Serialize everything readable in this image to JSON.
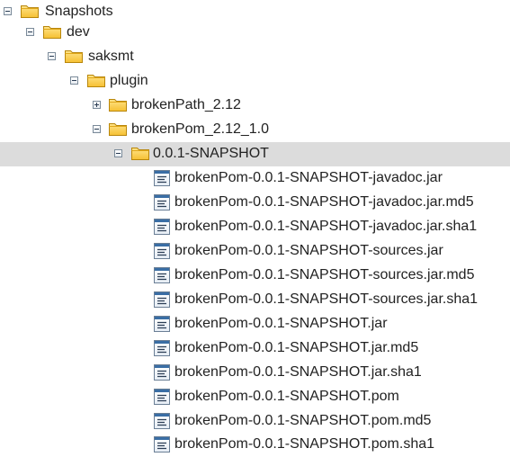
{
  "tree": {
    "folders": [
      {
        "label": "Snapshots",
        "state": "expanded",
        "icon": "folder-icon"
      },
      {
        "label": "dev",
        "state": "expanded",
        "icon": "folder-icon"
      },
      {
        "label": "saksmt",
        "state": "expanded",
        "icon": "folder-icon"
      },
      {
        "label": "plugin",
        "state": "expanded",
        "icon": "folder-icon"
      },
      {
        "label": "brokenPath_2.12",
        "state": "collapsed",
        "icon": "folder-icon"
      },
      {
        "label": "brokenPom_2.12_1.0",
        "state": "expanded",
        "icon": "folder-icon"
      },
      {
        "label": "0.0.1-SNAPSHOT",
        "state": "expanded",
        "icon": "folder-icon",
        "selected": true
      }
    ],
    "files": [
      {
        "label": "brokenPom-0.0.1-SNAPSHOT-javadoc.jar",
        "icon": "file-icon"
      },
      {
        "label": "brokenPom-0.0.1-SNAPSHOT-javadoc.jar.md5",
        "icon": "file-icon"
      },
      {
        "label": "brokenPom-0.0.1-SNAPSHOT-javadoc.jar.sha1",
        "icon": "file-icon"
      },
      {
        "label": "brokenPom-0.0.1-SNAPSHOT-sources.jar",
        "icon": "file-icon"
      },
      {
        "label": "brokenPom-0.0.1-SNAPSHOT-sources.jar.md5",
        "icon": "file-icon"
      },
      {
        "label": "brokenPom-0.0.1-SNAPSHOT-sources.jar.sha1",
        "icon": "file-icon"
      },
      {
        "label": "brokenPom-0.0.1-SNAPSHOT.jar",
        "icon": "file-icon"
      },
      {
        "label": "brokenPom-0.0.1-SNAPSHOT.jar.md5",
        "icon": "file-icon"
      },
      {
        "label": "brokenPom-0.0.1-SNAPSHOT.jar.sha1",
        "icon": "file-icon"
      },
      {
        "label": "brokenPom-0.0.1-SNAPSHOT.pom",
        "icon": "file-icon"
      },
      {
        "label": "brokenPom-0.0.1-SNAPSHOT.pom.md5",
        "icon": "file-icon"
      },
      {
        "label": "brokenPom-0.0.1-SNAPSHOT.pom.sha1",
        "icon": "file-icon"
      }
    ]
  },
  "colors": {
    "selection_bg": "#dcdcdc",
    "folder_fill": "#ffd24d",
    "folder_border": "#b8860b",
    "file_blue": "#3a6ea5"
  }
}
